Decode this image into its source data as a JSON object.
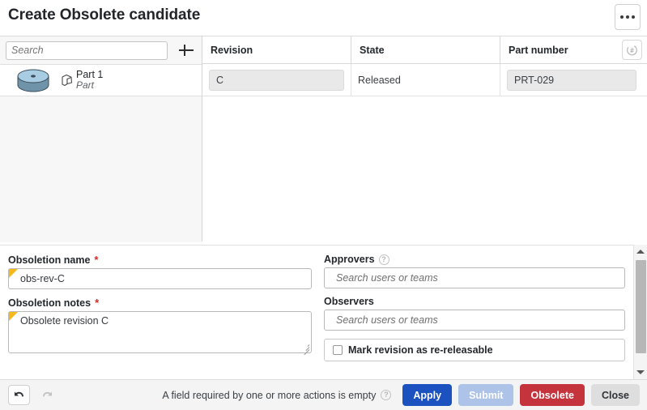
{
  "window": {
    "title": "Create Obsolete candidate",
    "overflow_menu_icon": "ellipsis-icon"
  },
  "tree": {
    "search": {
      "placeholder": "Search",
      "value": ""
    },
    "add_button_icon": "plus-icon",
    "items": [
      {
        "title": "Part 1",
        "subtitle": "Part",
        "thumbnail_icon": "cylinder-part-thumbnail",
        "type_icon": "part-icon",
        "selected": true
      }
    ]
  },
  "table": {
    "columns": [
      {
        "key": "revision",
        "label": "Revision"
      },
      {
        "key": "state",
        "label": "State"
      },
      {
        "key": "part_number",
        "label": "Part number"
      }
    ],
    "autonumber_icon": "autonumber-icon",
    "rows": [
      {
        "revision": "C",
        "state": "Released",
        "part_number": "PRT-029"
      }
    ]
  },
  "form": {
    "obsoletion_name": {
      "label": "Obsoletion name",
      "required_marker": "*",
      "value": "obs-rev-C",
      "modified": true
    },
    "obsoletion_notes": {
      "label": "Obsoletion notes",
      "required_marker": "*",
      "value": "Obsolete revision C",
      "modified": true
    },
    "approvers": {
      "label": "Approvers",
      "help_icon": "question-mark-icon",
      "placeholder": "Search users or teams",
      "value": ""
    },
    "observers": {
      "label": "Observers",
      "placeholder": "Search users or teams",
      "value": ""
    },
    "re_releasable": {
      "label": "Mark revision as re-releasable",
      "checked": false
    }
  },
  "footer": {
    "undo_icon": "undo-arrow-icon",
    "redo_icon": "redo-arrow-icon",
    "status_text": "A field required by one or more actions is empty",
    "status_help_icon": "question-mark-icon",
    "buttons": [
      {
        "key": "apply",
        "label": "Apply"
      },
      {
        "key": "submit",
        "label": "Submit"
      },
      {
        "key": "obsolete",
        "label": "Obsolete"
      },
      {
        "key": "close",
        "label": "Close"
      }
    ]
  },
  "colors": {
    "apply_blue": "#1b52c0",
    "submit_blue_disabled": "#adc3e8",
    "obsolete_red": "#c5333d",
    "close_gray": "#dedede",
    "required_red": "#cf2a2a",
    "modified_marker_yellow": "#f5b919"
  }
}
